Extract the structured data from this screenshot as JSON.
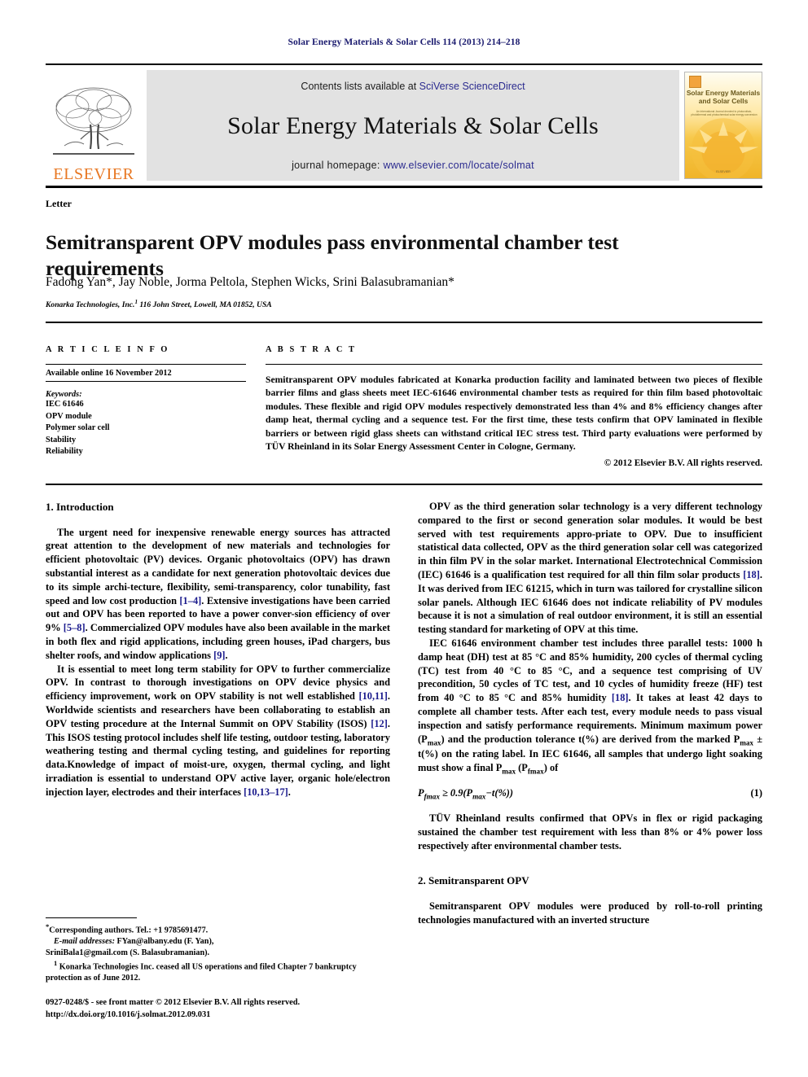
{
  "running_head": "Solar Energy Materials & Solar Cells 114 (2013) 214–218",
  "masthead": {
    "publisher_name": "ELSEVIER",
    "contents_prefix": "Contents lists available at ",
    "contents_link": "SciVerse ScienceDirect",
    "journal_title": "Solar Energy Materials & Solar Cells",
    "homepage_prefix": "journal homepage: ",
    "homepage_link": "www.elsevier.com/locate/solmat",
    "cover": {
      "title": "Solar Energy Materials and Solar Cells",
      "subtitle": "An International Journal devoted to photovoltaic, photothermal and photochemical solar energy conversion",
      "footer": "ELSEVIER"
    }
  },
  "article": {
    "doc_type": "Letter",
    "title": "Semitransparent OPV modules pass environmental chamber test requirements",
    "authors": "Fadong Yan*, Jay Noble, Jorma Peltola, Stephen Wicks, Srini Balasubramanian*",
    "affiliation": "Konarka Technologies, Inc.",
    "affiliation_marker": "1",
    "affiliation_rest": " 116 John Street, Lowell, MA 01852, USA"
  },
  "article_info": {
    "heading": "A R T I C L E   I N F O",
    "available_online": "Available online 16 November 2012",
    "keywords_label": "Keywords:",
    "keywords": [
      "IEC 61646",
      "OPV module",
      "Polymer solar cell",
      "Stability",
      "Reliability"
    ]
  },
  "abstract": {
    "heading": "A B S T R A C T",
    "body": "Semitransparent OPV modules fabricated at Konarka production facility and laminated between two pieces of flexible barrier films and glass sheets meet IEC-61646 environmental chamber tests as required for thin film based photovoltaic modules. These flexible and rigid OPV modules respectively demonstrated less than 4% and 8% efficiency changes after damp heat, thermal cycling and a sequence test. For the first time, these tests confirm that OPV laminated in flexible barriers or between rigid glass sheets can withstand critical IEC stress test. Third party evaluations were performed by TÜV Rheinland in its Solar Energy Assessment Center in Cologne, Germany.",
    "copyright": "© 2012 Elsevier B.V. All rights reserved."
  },
  "sections": {
    "intro_heading": "1.  Introduction",
    "intro_p1_a": "The urgent need for inexpensive renewable energy sources has attracted great attention to the development of new materials and technologies for efficient photovoltaic (PV) devices. Organic photovoltaics (OPV) has drawn substantial interest as a candidate for next generation photovoltaic devices due to its simple archi-tecture, flexibility, semi-transparency, color tunability, fast speed and low cost production ",
    "intro_p1_c1": "[1–4]",
    "intro_p1_b": ". Extensive investigations have been carried out and OPV has been reported to have a power conver-sion efficiency of over 9% ",
    "intro_p1_c2": "[5–8]",
    "intro_p1_d": ". Commercialized OPV modules have also been available in the market in both flex and rigid applications, including green houses, iPad chargers, bus shelter roofs, and window applications ",
    "intro_p1_c3": "[9]",
    "intro_p1_e": ".",
    "intro_p2_a": "It is essential to meet long term stability for OPV to further commercialize OPV. In contrast to thorough investigations on OPV device physics and efficiency improvement, work on OPV stability is not well established ",
    "intro_p2_c1": "[10,11]",
    "intro_p2_b": ". Worldwide scientists and researchers have been collaborating to establish an OPV testing procedure at the Internal Summit on OPV Stability (ISOS) ",
    "intro_p2_c2": "[12]",
    "intro_p2_c": ". This ISOS testing protocol includes shelf life testing, outdoor testing, laboratory weathering testing and thermal cycling testing, and guidelines for reporting data.Knowledge of impact of moist-ure, oxygen, thermal cycling, and light irradiation is essential to understand OPV active layer, organic hole/electron injection layer, electrodes and their interfaces ",
    "intro_p2_c3": "[10,13–17]",
    "intro_p2_d": ".",
    "right_p1_a": "OPV as the third generation solar technology is a very different technology compared to the first or second generation solar modules. It would be best served with test requirements appro-priate to OPV. Due to insufficient statistical data collected, OPV as the third generation solar cell was categorized in thin film PV in the solar market. International Electrotechnical Commission (IEC) 61646 is a qualification test required for all thin film solar products ",
    "right_p1_c1": "[18]",
    "right_p1_b": ". It was derived from IEC 61215, which in turn was tailored for crystalline silicon solar panels. Although IEC 61646 does not indicate reliability of PV modules because it is not a simulation of real outdoor environment, it is still an essential testing standard for marketing of OPV at this time.",
    "right_p2_a": "IEC 61646 environment chamber test includes three parallel tests: 1000 h damp heat (DH) test at 85 °C and 85% humidity, 200 cycles of thermal cycling (TC) test from 40 °C to 85 °C, and a sequence test comprising of UV precondition, 50 cycles of TC test, and 10 cycles of humidity freeze (HF) test from 40 °C to 85 °C and 85% humidity ",
    "right_p2_c1": "[18]",
    "right_p2_b": ". It takes at least 42 days to complete all chamber tests. After each test, every module needs to pass visual inspection and satisfy performance requirements. Minimum maximum power (P",
    "right_p2_sub1": "max",
    "right_p2_c": ") and the production tolerance t(%) are derived from the marked P",
    "right_p2_sub2": "max",
    "right_p2_d": " ± t(%) on the rating label. In IEC 61646, all samples that undergo light soaking must show a final P",
    "right_p2_sub3": "max",
    "right_p2_e": " (P",
    "right_p2_sub4": "fmax",
    "right_p2_f": ") of",
    "equation": {
      "lhs_p": "P",
      "lhs_sub": "fmax",
      "rel": " ≥ 0.9(P",
      "rhs_sub": "max",
      "rhs_tail": "−t(%))",
      "number": "(1)"
    },
    "right_p3": "TÜV Rheinland results confirmed that OPVs in flex or rigid packaging sustained the chamber test requirement with less than 8% or 4% power loss respectively after environmental chamber tests.",
    "sec2_heading": "2.  Semitransparent OPV",
    "sec2_p1": "Semitransparent OPV modules were produced by roll-to-roll printing technologies manufactured with an inverted structure"
  },
  "footnotes": {
    "corresponding": "Corresponding authors. Tel.: +1 9785691477.",
    "email_label": "E-mail addresses:",
    "email_1": " FYan@albany.edu (F. Yan),",
    "email_2": "SriniBala1@gmail.com (S. Balasubramanian).",
    "note_marker": "1",
    "note_text": " Konarka Technologies Inc. ceased all US operations and filed Chapter 7 bankruptcy protection as of June 2012.",
    "front_matter": "0927-0248/$ - see front matter © 2012 Elsevier B.V. All rights reserved.",
    "doi": "http://dx.doi.org/10.1016/j.solmat.2012.09.031"
  },
  "colors": {
    "link_blue": "#2b2b8f",
    "citation_blue": "#1a1a8c",
    "elsevier_orange": "#e87722",
    "running_head_navy": "#1a1a6e",
    "band_gray": "#e2e2e2"
  }
}
